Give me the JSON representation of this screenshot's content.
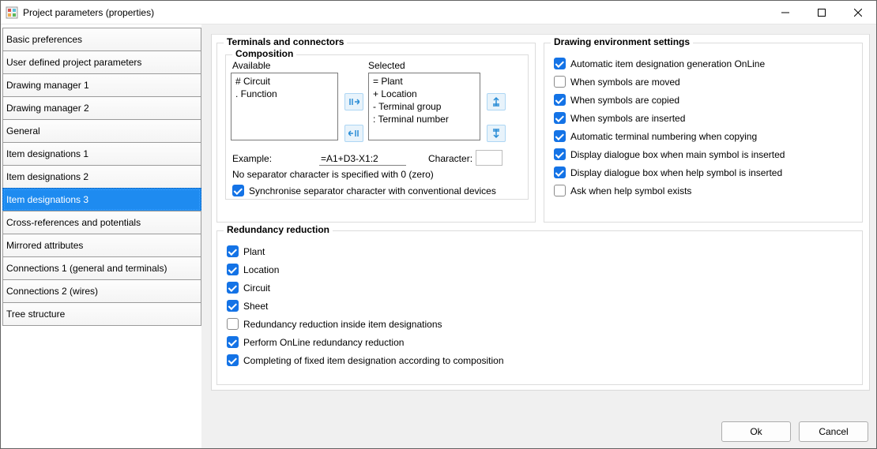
{
  "window": {
    "title": "Project parameters (properties)"
  },
  "sidebar": {
    "items": [
      {
        "label": "Basic preferences"
      },
      {
        "label": "User defined project parameters"
      },
      {
        "label": "Drawing manager 1"
      },
      {
        "label": "Drawing manager 2"
      },
      {
        "label": "General"
      },
      {
        "label": "Item designations 1"
      },
      {
        "label": "Item designations 2"
      },
      {
        "label": "Item designations 3"
      },
      {
        "label": "Cross-references and potentials"
      },
      {
        "label": "Mirrored attributes"
      },
      {
        "label": "Connections 1 (general and terminals)"
      },
      {
        "label": "Connections 2 (wires)"
      },
      {
        "label": "Tree structure"
      }
    ],
    "selected_index": 7
  },
  "terminals": {
    "group_title": "Terminals and connectors",
    "composition_title": "Composition",
    "available_label": "Available",
    "selected_label": "Selected",
    "available_items": [
      "# Circuit",
      ". Function"
    ],
    "selected_items": [
      "= Plant",
      "+ Location",
      "- Terminal group",
      ": Terminal number"
    ],
    "example_label": "Example:",
    "example_value": "=A1+D3-X1:2",
    "character_label": "Character:",
    "character_value": "",
    "separator_note": "No separator character is specified with 0 (zero)",
    "sync_checkbox": "Synchronise separator character with conventional devices",
    "sync_checked": true
  },
  "drawing_env": {
    "group_title": "Drawing environment settings",
    "options": [
      {
        "label": "Automatic item designation generation OnLine",
        "checked": true
      },
      {
        "label": "When symbols are moved",
        "checked": false
      },
      {
        "label": "When symbols are copied",
        "checked": true
      },
      {
        "label": "When symbols are inserted",
        "checked": true
      },
      {
        "label": "Automatic terminal numbering when copying",
        "checked": true
      },
      {
        "label": "Display dialogue box when main symbol is inserted",
        "checked": true
      },
      {
        "label": "Display dialogue box when help symbol is inserted",
        "checked": true
      },
      {
        "label": "Ask when help symbol exists",
        "checked": false
      }
    ]
  },
  "redundancy": {
    "group_title": "Redundancy reduction",
    "options": [
      {
        "label": "Plant",
        "checked": true
      },
      {
        "label": "Location",
        "checked": true
      },
      {
        "label": "Circuit",
        "checked": true
      },
      {
        "label": "Sheet",
        "checked": true
      },
      {
        "label": "Redundancy reduction inside item designations",
        "checked": false
      },
      {
        "label": "Perform OnLine redundancy reduction",
        "checked": true
      },
      {
        "label": "Completing of fixed item designation according to composition",
        "checked": true
      }
    ]
  },
  "buttons": {
    "ok": "Ok",
    "cancel": "Cancel"
  }
}
